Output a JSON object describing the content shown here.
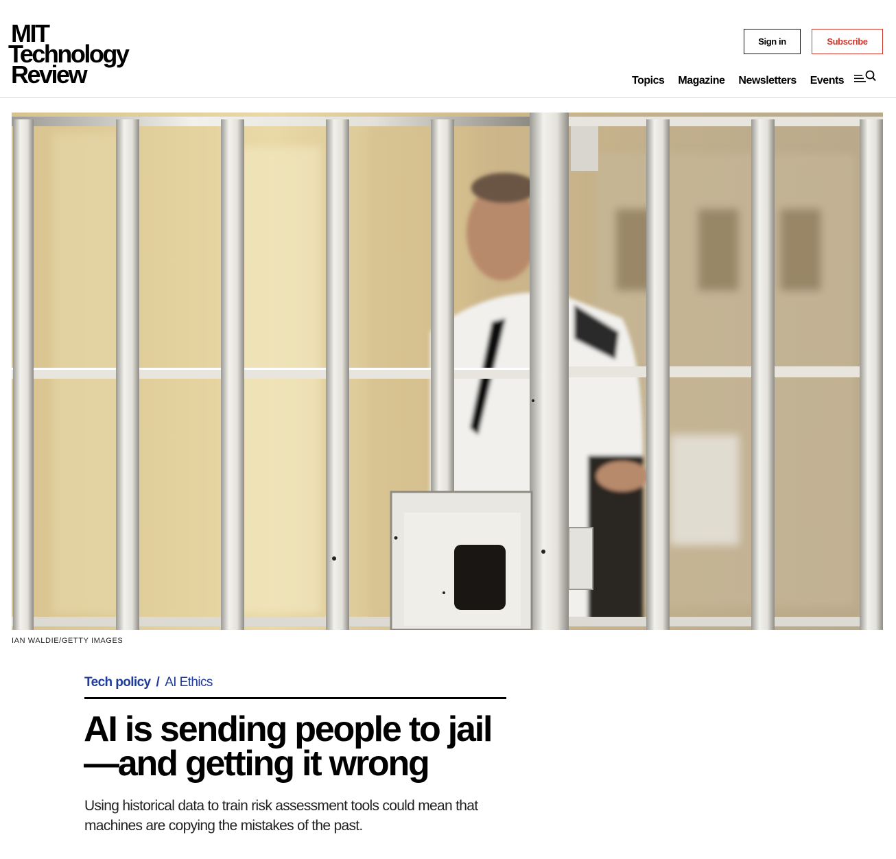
{
  "brand": {
    "logo_line1": "MIT",
    "logo_line2": "Technology",
    "logo_line3": "Review"
  },
  "header": {
    "signin_label": "Sign in",
    "subscribe_label": "Subscribe",
    "subscribe_color": "#d2362b",
    "nav": [
      "Topics",
      "Magazine",
      "Newsletters",
      "Events"
    ],
    "menu_icon": "menu-search-icon"
  },
  "hero": {
    "caption": "IAN WALDIE/GETTY IMAGES"
  },
  "article": {
    "topic": "Tech policy",
    "separator": "/",
    "subtopic": "AI Ethics",
    "topic_color": "#1f3c9c",
    "headline": "AI is sending people to jail—and getting it wrong",
    "dek": "Using historical data to train risk assessment tools could mean that machines are copying the mistakes of the past."
  }
}
